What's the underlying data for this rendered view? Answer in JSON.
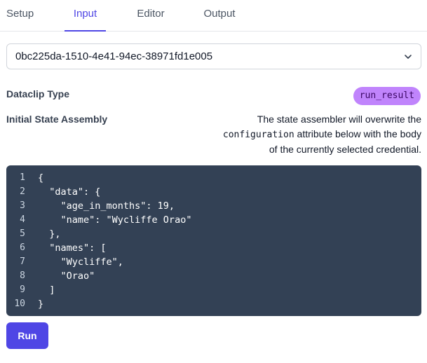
{
  "tabs": [
    {
      "label": "Setup",
      "active": false
    },
    {
      "label": "Input",
      "active": true
    },
    {
      "label": "Editor",
      "active": false
    },
    {
      "label": "Output",
      "active": false
    }
  ],
  "dataclip_select": {
    "value": "0bc225da-1510-4e41-94ec-38971fd1e005",
    "icon": "chevron-down-icon"
  },
  "dataclip_type": {
    "label": "Dataclip Type",
    "badge": "run_result"
  },
  "initial_state": {
    "label": "Initial State Assembly",
    "note_before": "The state assembler will overwrite the",
    "note_code": "configuration",
    "note_after": "attribute below with the body of the currently selected credential."
  },
  "editor": {
    "line_numbers": [
      "1",
      "2",
      "3",
      "4",
      "5",
      "6",
      "7",
      "8",
      "9",
      "10"
    ],
    "lines": [
      "{",
      "  \"data\": {",
      "    \"age_in_months\": 19,",
      "    \"name\": \"Wycliffe Orao\"",
      "  },",
      "  \"names\": [",
      "    \"Wycliffe\",",
      "    \"Orao\"",
      "  ]",
      "}"
    ]
  },
  "actions": {
    "run_label": "Run"
  },
  "colors": {
    "accent": "#4f46e5",
    "badge_bg": "#c084fc",
    "editor_bg": "#334155"
  }
}
